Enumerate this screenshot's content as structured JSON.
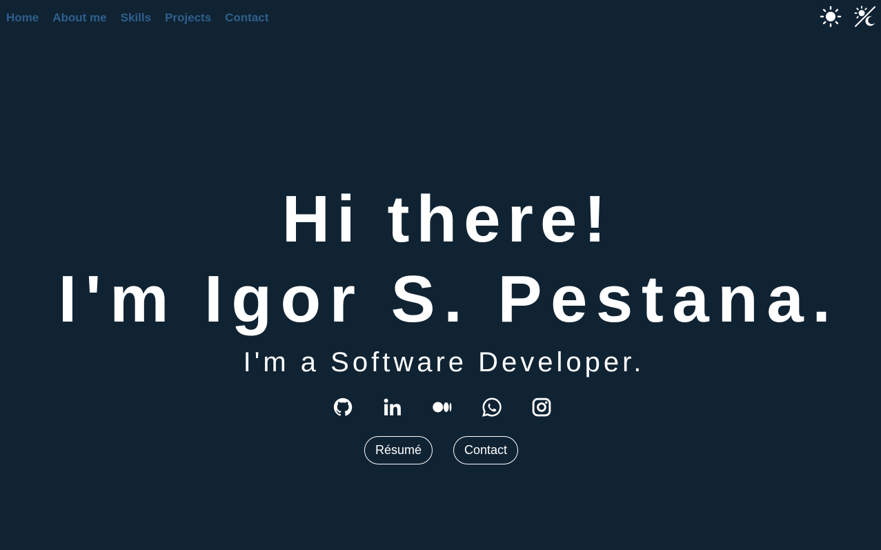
{
  "nav": {
    "items": [
      {
        "label": "Home"
      },
      {
        "label": "About me"
      },
      {
        "label": "Skills"
      },
      {
        "label": "Projects"
      },
      {
        "label": "Contact"
      }
    ]
  },
  "theme_toggles": {
    "light_icon": "sun-icon",
    "auto_icon": "sun-moon-icon"
  },
  "hero": {
    "greeting": "Hi there!",
    "name_line": "I'm Igor S. Pestana.",
    "subtitle": "I'm a Software Developer."
  },
  "socials": [
    {
      "icon": "github-icon"
    },
    {
      "icon": "linkedin-icon"
    },
    {
      "icon": "medium-icon"
    },
    {
      "icon": "whatsapp-icon"
    },
    {
      "icon": "instagram-icon"
    }
  ],
  "buttons": {
    "resume_label": "Résumé",
    "contact_label": "Contact"
  },
  "colors": {
    "background": "#102333",
    "nav_link": "#2f5f8c",
    "text": "#ffffff"
  }
}
